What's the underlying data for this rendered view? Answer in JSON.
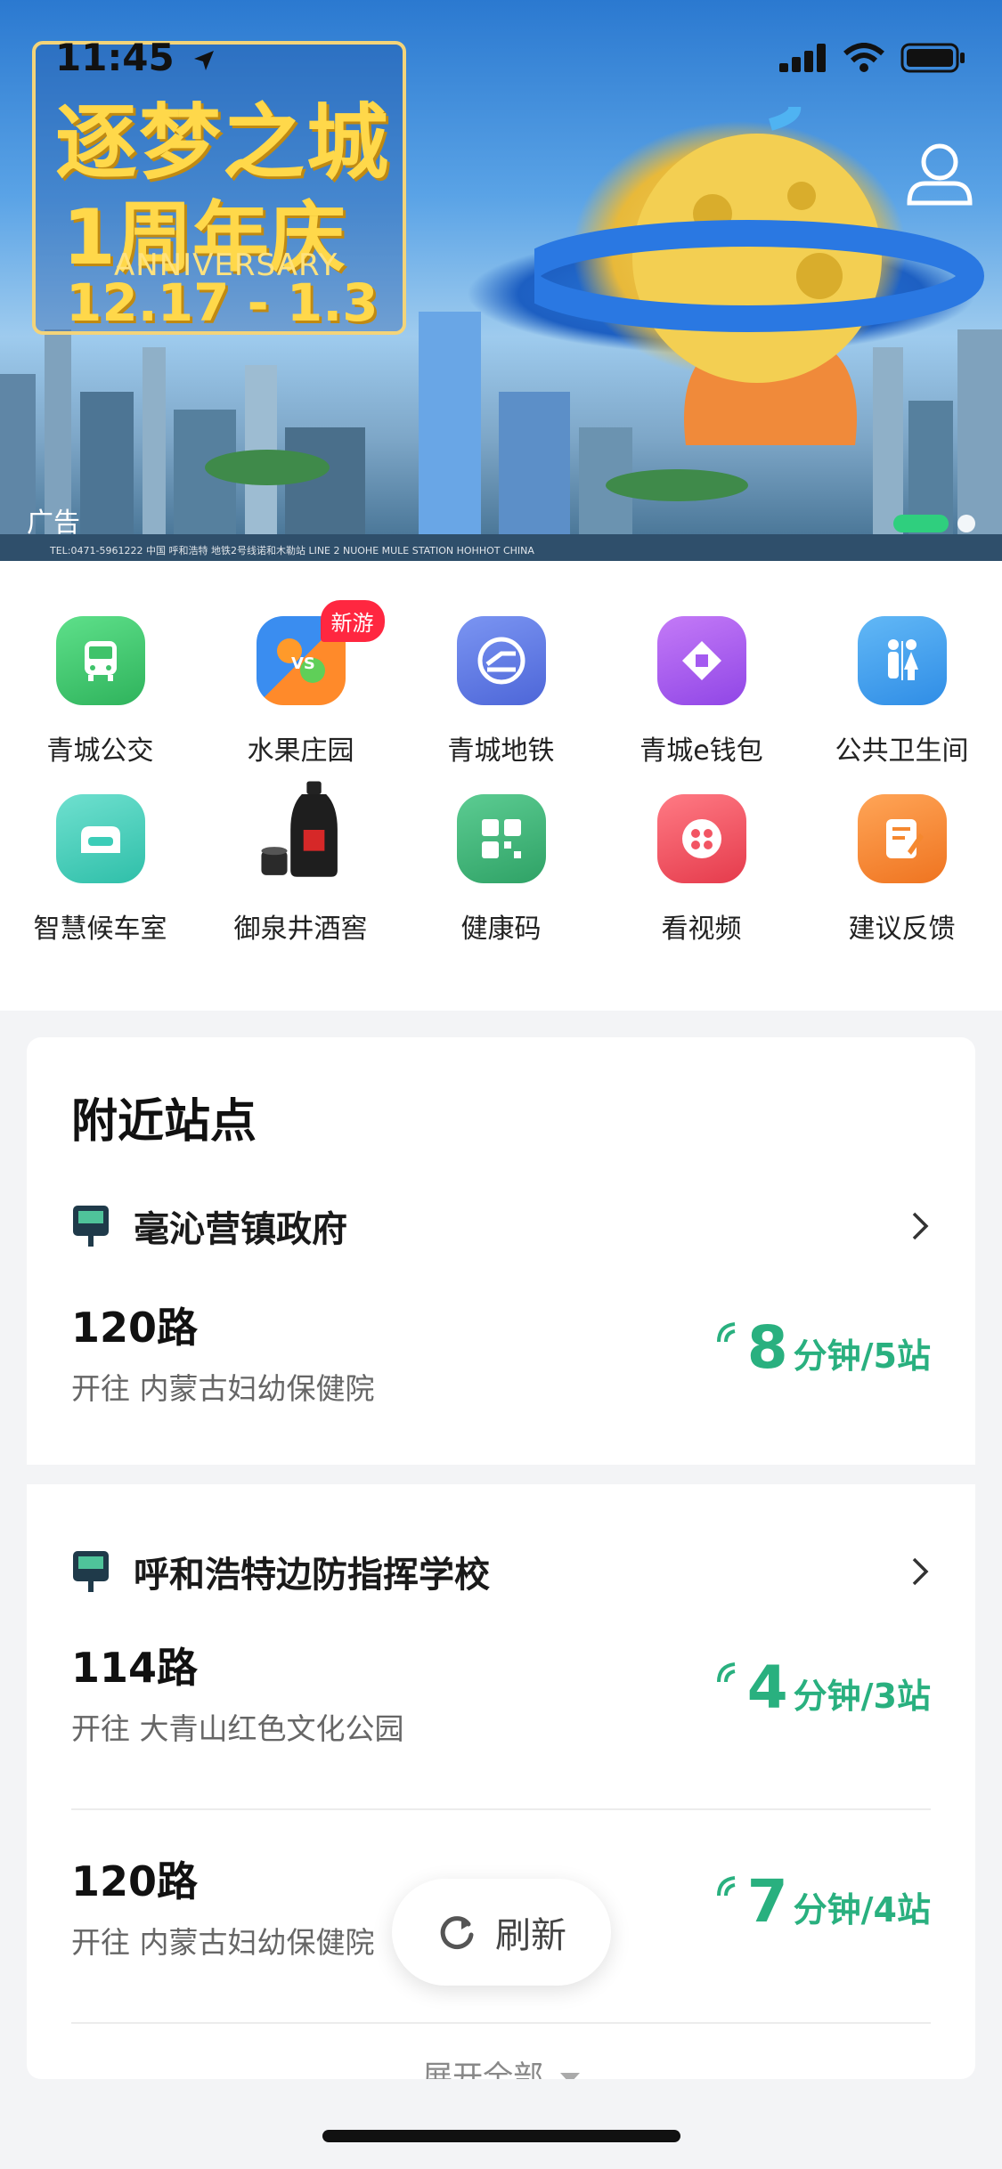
{
  "status_bar": {
    "time": "11:45"
  },
  "banner": {
    "headline": "逐梦之城",
    "subtitle": "周年庆",
    "anniversary_number": "1",
    "anniversary_text": "ANNIVERSARY",
    "dates": "12.17 - 1.3",
    "ad_label": "广告",
    "footer_text": "TEL:0471-5961222  中国 呼和浩特 地铁2号线诺和木勒站 LINE 2 NUOHE MULE STATION HOHHOT CHINA"
  },
  "quick_grid": [
    {
      "label": "青城公交",
      "icon": "bus-icon",
      "color": "#3fc36a"
    },
    {
      "label": "水果庄园",
      "icon": "fruit-game-icon",
      "color": "#ff8a2a",
      "badge": "新游"
    },
    {
      "label": "青城地铁",
      "icon": "metro-icon",
      "color": "#5b7de8"
    },
    {
      "label": "青城e钱包",
      "icon": "wallet-icon",
      "color": "#a45af0"
    },
    {
      "label": "公共卫生间",
      "icon": "restroom-icon",
      "color": "#3a9ef0"
    },
    {
      "label": "智慧候车室",
      "icon": "waiting-room-icon",
      "color": "#3ccdb8"
    },
    {
      "label": "御泉井酒窖",
      "icon": "liquor-bottle-icon",
      "color": "#222222"
    },
    {
      "label": "健康码",
      "icon": "health-code-icon",
      "color": "#3db67a"
    },
    {
      "label": "看视频",
      "icon": "video-icon",
      "color": "#f25563"
    },
    {
      "label": "建议反馈",
      "icon": "feedback-icon",
      "color": "#f5882f"
    }
  ],
  "nearby": {
    "title": "附近站点",
    "stations": [
      {
        "name": "毫沁营镇政府",
        "routes": [
          {
            "route": "120路",
            "destination": "开往 内蒙古妇幼保健院",
            "minutes": "8",
            "unit": "分钟/5站"
          }
        ]
      },
      {
        "name": "呼和浩特边防指挥学校",
        "routes": [
          {
            "route": "114路",
            "destination": "开往 大青山红色文化公园",
            "minutes": "4",
            "unit": "分钟/3站"
          },
          {
            "route": "120路",
            "destination": "开往 内蒙古妇幼保健院",
            "minutes": "7",
            "unit": "分钟/4站"
          }
        ]
      }
    ],
    "expand_label": "展开全部"
  },
  "refresh": {
    "label": "刷新"
  },
  "colors": {
    "accent": "#29b07f",
    "badge": "#ff2740"
  }
}
